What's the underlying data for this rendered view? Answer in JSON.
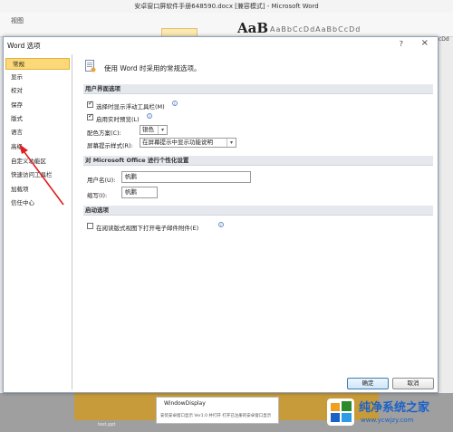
{
  "app": {
    "window_title": "安卓窗口屏软件手册648590.docx [兼容模式] - Microsoft Word",
    "ribbon_tab": "视图",
    "style_sample": "AaB",
    "style_strip": "AaBbCcDdAaBbCcDd",
    "style_right": "cDd"
  },
  "dialog": {
    "title": "Word 选项",
    "help": "?",
    "close": "×",
    "nav": [
      {
        "label": "常规",
        "active": true
      },
      {
        "label": "显示"
      },
      {
        "label": "校对"
      },
      {
        "label": "保存"
      },
      {
        "label": "版式"
      },
      {
        "label": "语言"
      },
      {
        "label": "高级"
      },
      {
        "label": "自定义功能区"
      },
      {
        "label": "快速访问工具栏"
      },
      {
        "label": "加载项"
      },
      {
        "label": "信任中心"
      }
    ],
    "intro": "使用 Word 时采用的常规选项。",
    "sections": {
      "ui": "用户界面选项",
      "personalize": "对 Microsoft Office 进行个性化设置",
      "startup": "启动选项"
    },
    "options": {
      "mini_toolbar": {
        "label": "选择时显示浮动工具栏(M)",
        "checked": true
      },
      "live_preview": {
        "label": "启用实时预览(L)",
        "checked": true
      },
      "color_scheme_label": "配色方案(C):",
      "color_scheme_value": "银色",
      "screentip_label": "屏幕提示样式(R):",
      "screentip_value": "在屏幕提示中显示功能说明",
      "username_label": "用户名(U):",
      "username_value": "帆鹏",
      "initials_label": "缩写(I):",
      "initials_value": "帆鹏",
      "reading_view": {
        "label": "在阅读版式视图下打开电子邮件附件(E)",
        "checked": false
      }
    },
    "buttons": {
      "ok": "确定",
      "cancel": "取消"
    }
  },
  "background": {
    "popup_title": "WindowDisplay",
    "popup_text": "安装安卓窗口显示 Ver1.0 并打开 打开已注册的安卓窗口显示",
    "file_name": "test.ppt"
  },
  "watermark": {
    "brand": "纯净系统之家",
    "url": "www.ycwjzy.com"
  },
  "colors": {
    "nav_active_bg": "#fbd978",
    "section_bg": "#e5e9ee",
    "annotation_arrow": "#e02020",
    "watermark_blue": "#1a62c8"
  }
}
